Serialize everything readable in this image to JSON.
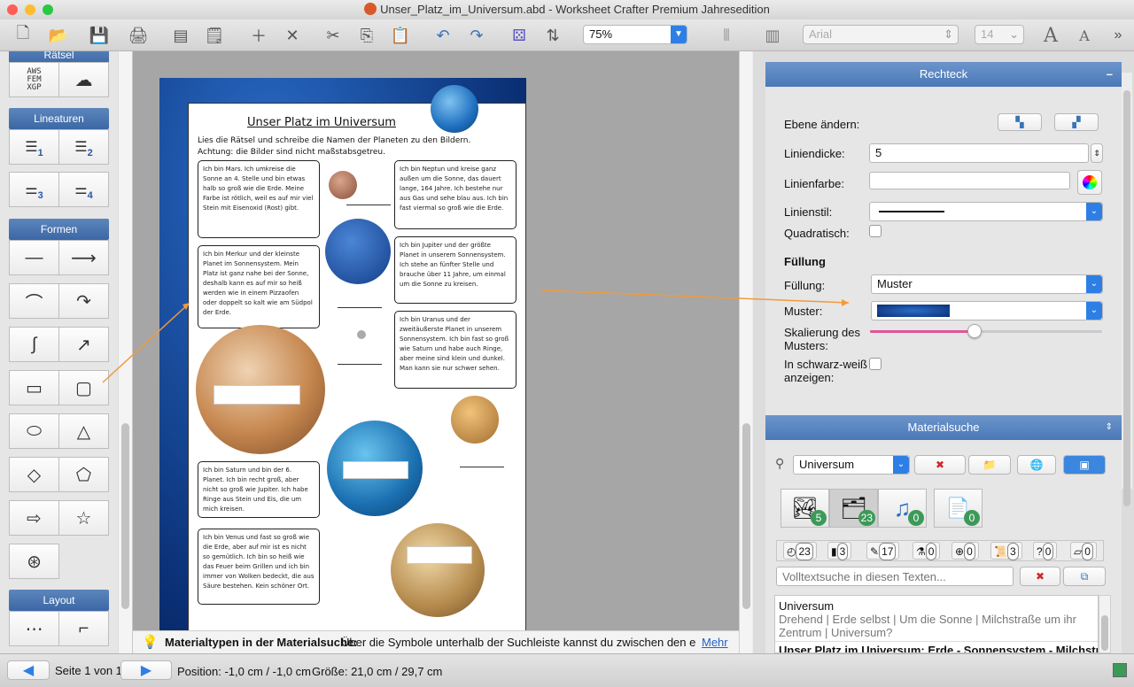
{
  "window": {
    "title": "Unser_Platz_im_Universum.abd  - Worksheet Crafter Premium Jahresedition"
  },
  "toolbar": {
    "zoom": "75%",
    "font": "Arial",
    "font_size": "14"
  },
  "left_panel": {
    "sections": {
      "raetsel": "Rätsel",
      "lineaturen": "Lineaturen",
      "formen": "Formen",
      "layout": "Layout"
    },
    "lineatur_numbers": [
      "1",
      "2",
      "3",
      "4"
    ]
  },
  "worksheet": {
    "title": "Unser Platz im Universum",
    "instruction_line1": "Lies die Rätsel und schreibe die Namen der Planeten zu den Bildern.",
    "instruction_line2": "Achtung: die Bilder sind nicht maßstabsgetreu.",
    "boxes": {
      "mars": "Ich bin Mars. Ich umkreise die Sonne an 4. Stelle und bin etwas halb so groß wie die Erde. Meine Farbe ist rötlich, weil es auf mir viel Stein mit Eisenoxid (Rost) gibt.",
      "merkur": "Ich bin Merkur und der kleinste Planet im Sonnensystem. Mein Platz ist ganz nahe bei der Sonne, deshalb kann es auf mir so heiß werden wie in einem Pizzaofen oder doppelt so kalt wie am Südpol der Erde.",
      "saturn": "Ich bin Saturn und bin der 6. Planet. Ich bin recht groß, aber nicht so groß wie Jupiter. Ich habe Ringe aus Stein und Eis, die um mich kreisen.",
      "venus": "Ich bin Venus und fast so groß wie die Erde, aber auf mir ist es nicht so gemütlich. Ich bin so heiß wie das Feuer beim Grillen und ich bin immer von Wolken bedeckt, die aus Säure bestehen. Kein schöner Ort.",
      "neptun": "Ich bin Neptun und kreise ganz außen um die Sonne, das dauert lange, 164 Jahre. Ich bestehe nur aus Gas und sehe blau aus. Ich bin fast viermal so groß wie die Erde.",
      "jupiter": "Ich bin Jupiter und der größte Planet in unserem Sonnensystem. Ich stehe an fünfter Stelle und brauche über 11 Jahre, um einmal um die Sonne zu kreisen.",
      "uranus": "Ich bin Uranus und der zweitäußerste Planet in unserem Sonnensystem. Ich bin fast so groß wie Saturn und habe auch Ringe, aber meine sind klein und dunkel. Man kann sie nur schwer sehen."
    }
  },
  "hint_bar": {
    "bold": "Materialtypen in der Materialsuche:",
    "text": "Über die Symbole unterhalb der Suchleiste kannst du zwischen den einz...",
    "more": "Mehr"
  },
  "status": {
    "page": "Seite 1 von 1",
    "position": "Position: -1,0 cm / -1,0 cm",
    "size": "Größe: 21,0 cm / 29,7 cm"
  },
  "properties": {
    "header": "Rechteck",
    "ebene_label": "Ebene ändern:",
    "liniendicke_label": "Liniendicke:",
    "liniendicke_value": "5",
    "linienfarbe_label": "Linienfarbe:",
    "linienstil_label": "Linienstil:",
    "quadratisch_label": "Quadratisch:",
    "fuellung_heading": "Füllung",
    "fuellung_label": "Füllung:",
    "fuellung_value": "Muster",
    "muster_label": "Muster:",
    "skalierung_label_1": "Skalierung des",
    "skalierung_label_2": "Musters:",
    "sw_label_1": "In schwarz-weiß",
    "sw_label_2": "anzeigen:",
    "scale_fraction": 0.45,
    "accent": "#e0559a"
  },
  "material": {
    "header": "Materialsuche",
    "search_value": "Universum",
    "categories": [
      {
        "icon": "image-icon",
        "count": "5"
      },
      {
        "icon": "worksheet-icon",
        "count": "23"
      },
      {
        "icon": "music-note-icon",
        "count": "0"
      },
      {
        "icon": "document-icon",
        "count": "0"
      }
    ],
    "filters": [
      "23",
      "3",
      "17",
      "0",
      "0",
      "3",
      "0",
      "0"
    ],
    "fulltext_placeholder": "Volltextsuche in diesen Texten...",
    "results": [
      {
        "title": "Universum",
        "detail": "Drehend | Erde selbst | Um die Sonne | Milchstraße um ihr Zentrum | Universum?"
      },
      {
        "title": "Unser Platz im Universum: Erde - Sonnensystem - Milchstraße"
      }
    ]
  }
}
